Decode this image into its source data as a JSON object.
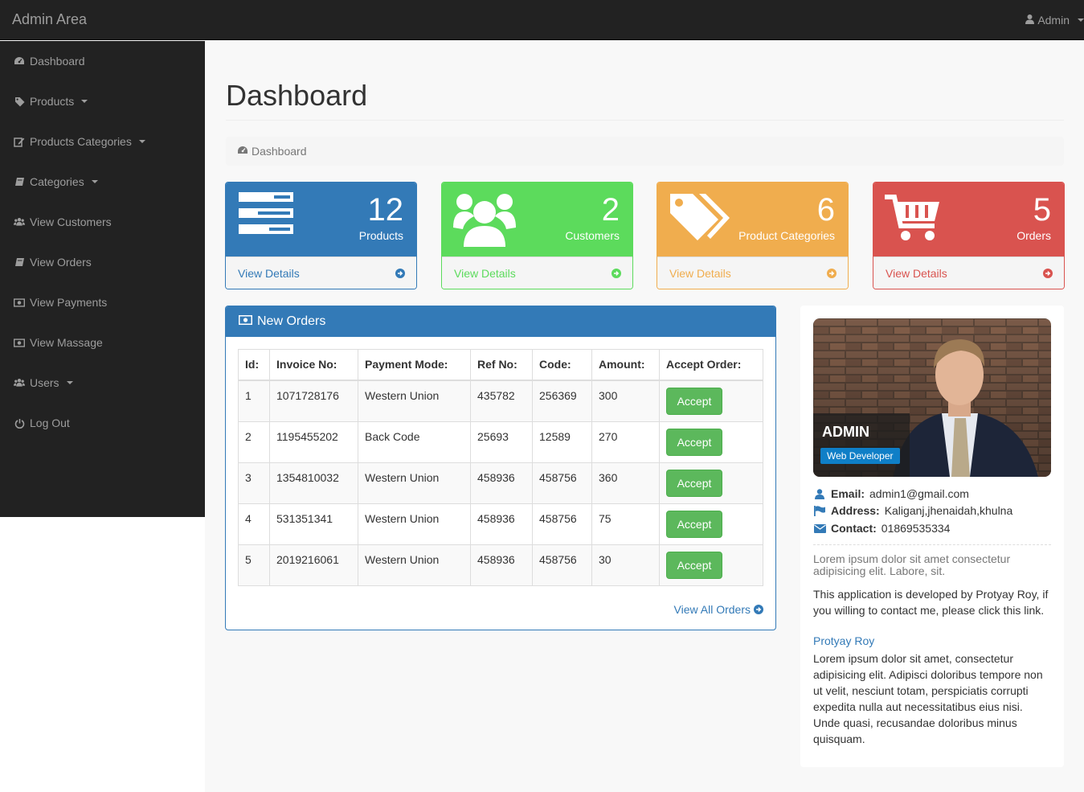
{
  "navbar": {
    "brand": "Admin Area",
    "user_label": "Admin"
  },
  "sidebar": {
    "items": [
      {
        "label": "Dashboard",
        "icon": "dashboard-icon",
        "dropdown": false
      },
      {
        "label": "Products",
        "icon": "tag-icon",
        "dropdown": true
      },
      {
        "label": "Products Categories",
        "icon": "edit-icon",
        "dropdown": true
      },
      {
        "label": "Categories",
        "icon": "book-icon",
        "dropdown": true
      },
      {
        "label": "View Customers",
        "icon": "users-icon",
        "dropdown": false
      },
      {
        "label": "View Orders",
        "icon": "book-icon",
        "dropdown": false
      },
      {
        "label": "View Payments",
        "icon": "money-icon",
        "dropdown": false
      },
      {
        "label": "View Massage",
        "icon": "money-icon",
        "dropdown": false
      },
      {
        "label": "Users",
        "icon": "users-icon",
        "dropdown": true
      },
      {
        "label": "Log Out",
        "icon": "power-off-icon",
        "dropdown": false
      }
    ]
  },
  "page": {
    "title": "Dashboard",
    "breadcrumb": "Dashboard"
  },
  "stats": [
    {
      "count": "12",
      "label": "Products",
      "link": "View Details",
      "icon": "tasks-icon",
      "color": "#337ab7"
    },
    {
      "count": "2",
      "label": "Customers",
      "link": "View Details",
      "icon": "users-icon",
      "color": "#5cdb5c"
    },
    {
      "count": "6",
      "label": "Product Categories",
      "link": "View Details",
      "icon": "tags-icon",
      "color": "#f0ad4e"
    },
    {
      "count": "5",
      "label": "Orders",
      "link": "View Details",
      "icon": "shopping-cart-icon",
      "color": "#d9534f"
    }
  ],
  "orders": {
    "title": "New Orders",
    "columns": [
      "Id:",
      "Invoice No:",
      "Payment Mode:",
      "Ref No:",
      "Code:",
      "Amount:",
      "Accept Order:"
    ],
    "rows": [
      [
        "1",
        "1071728176",
        "Western Union",
        "435782",
        "256369",
        "300"
      ],
      [
        "2",
        "1195455202",
        "Back Code",
        "25693",
        "12589",
        "270"
      ],
      [
        "3",
        "1354810032",
        "Western Union",
        "458936",
        "458756",
        "360"
      ],
      [
        "4",
        "531351341",
        "Western Union",
        "458936",
        "458756",
        "75"
      ],
      [
        "5",
        "2019216061",
        "Western Union",
        "458936",
        "458756",
        "30"
      ]
    ],
    "accept_label": "Accept",
    "view_all": "View All Orders"
  },
  "profile": {
    "name": "ADMIN",
    "role": "Web Developer",
    "email_label": "Email:",
    "email": "admin1@gmail.com",
    "address_label": "Address:",
    "address": "Kaliganj,jhenaidah,khulna",
    "contact_label": "Contact:",
    "contact": "01869535334",
    "lead": "Lorem ipsum dolor sit amet consectetur adipisicing elit. Labore, sit.",
    "about": "This application is developed by Protyay Roy, if you willing to contact me, please click this link.",
    "link": "Protyay Roy",
    "bio": "Lorem ipsum dolor sit amet, consectetur adipisicing elit. Adipisci doloribus tempore non ut velit, nesciunt totam, perspiciatis corrupti expedita nulla aut necessitatibus eius nisi. Unde quasi, recusandae doloribus minus quisquam."
  }
}
